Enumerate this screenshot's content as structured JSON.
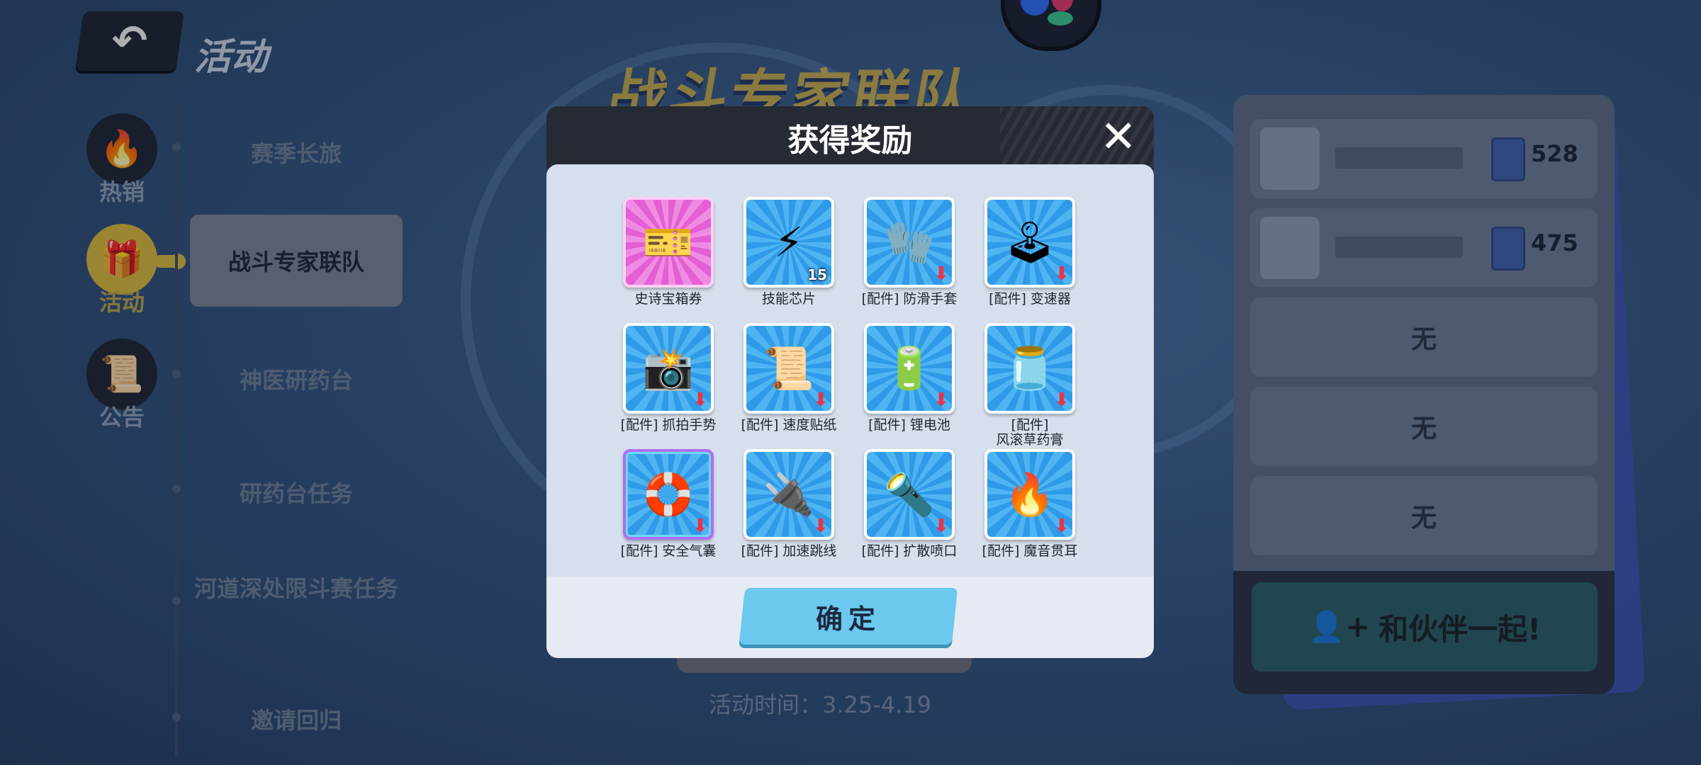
{
  "header": {
    "back_glyph": "↶",
    "title": "活动"
  },
  "event_title": "战斗专家联队",
  "side_nav": [
    {
      "icon": "flame-icon",
      "glyph": "🔥",
      "label": "热销"
    },
    {
      "icon": "gift-icon",
      "glyph": "🎁",
      "label": "活动",
      "active": true
    },
    {
      "icon": "scroll-icon",
      "glyph": "📜",
      "label": "公告"
    }
  ],
  "menu": [
    "赛季长旅",
    "战斗专家联队",
    "神医研药台",
    "研药台任务",
    "河道深处限斗赛任务",
    "邀请回归"
  ],
  "right_panel": {
    "scores": [
      "528",
      "475"
    ],
    "empty_label": "无",
    "team_button": "和伙伴一起!",
    "team_glyph": "👤+"
  },
  "period": "活动时间：3.25-4.19",
  "modal": {
    "title": "获得奖励",
    "close_glyph": "✕",
    "confirm": "确定",
    "rewards": [
      {
        "label": "史诗宝箱券",
        "icon": "ticket-icon",
        "glyph": "🎫",
        "tile": "pink"
      },
      {
        "label": "技能芯片",
        "icon": "chip-icon",
        "glyph": "⚡",
        "tile": "blue",
        "count": "15"
      },
      {
        "label": "[配件] 防滑手套",
        "icon": "glove-icon",
        "glyph": "🧤",
        "tile": "blue",
        "arrow": true
      },
      {
        "label": "[配件] 变速器",
        "icon": "gear-shift-icon",
        "glyph": "🕹",
        "tile": "blue",
        "arrow": true
      },
      {
        "label": "[配件] 抓拍手势",
        "icon": "camera-hand-icon",
        "glyph": "📸",
        "tile": "blue",
        "arrow": true
      },
      {
        "label": "[配件] 速度贴纸",
        "icon": "sticker-icon",
        "glyph": "📜",
        "tile": "blue",
        "arrow": true
      },
      {
        "label": "[配件] 锂电池",
        "icon": "battery-icon",
        "glyph": "🔋",
        "tile": "blue",
        "arrow": true
      },
      {
        "label": "[配件]\n风滚草药膏",
        "icon": "ointment-icon",
        "glyph": "🫙",
        "tile": "blue",
        "arrow": true
      },
      {
        "label": "[配件] 安全气囊",
        "icon": "airbag-icon",
        "glyph": "🛟",
        "tile": "blue-special",
        "arrow": true
      },
      {
        "label": "[配件] 加速跳线",
        "icon": "cable-icon",
        "glyph": "🔌",
        "tile": "blue",
        "arrow": true
      },
      {
        "label": "[配件] 扩散喷口",
        "icon": "nozzle-icon",
        "glyph": "🔦",
        "tile": "blue",
        "arrow": true
      },
      {
        "label": "[配件] 魔音贯耳",
        "icon": "sound-wave-icon",
        "glyph": "🔥",
        "tile": "blue",
        "arrow": true
      }
    ],
    "arrow_glyph": "⬇"
  }
}
